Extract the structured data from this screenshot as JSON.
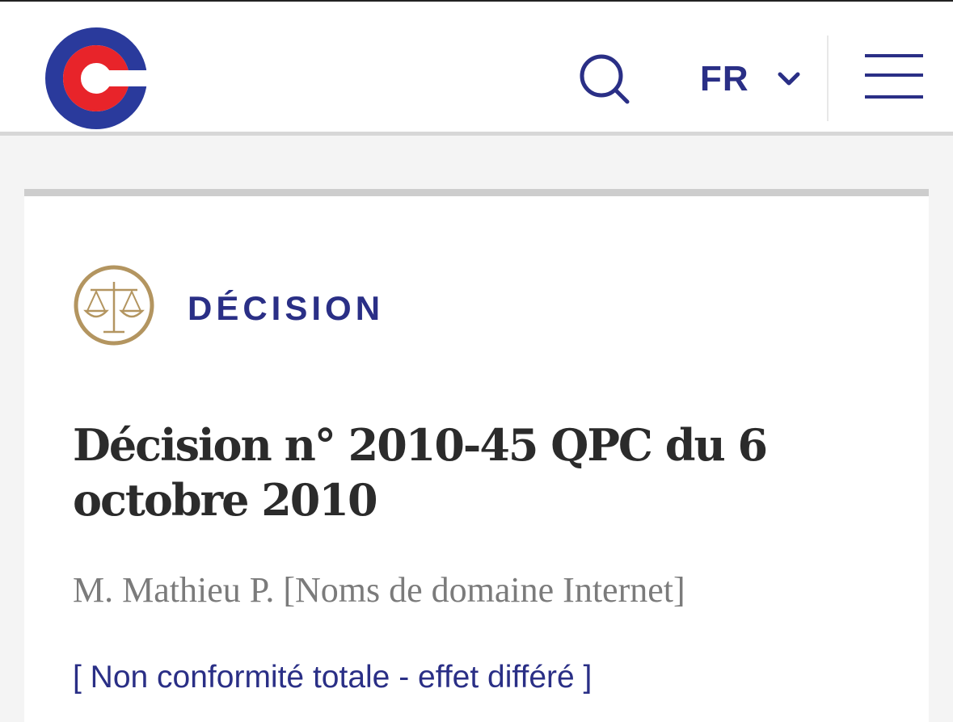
{
  "header": {
    "language": "FR"
  },
  "brand": {
    "blue": "#2a3a9c",
    "red": "#e8242a",
    "gold": "#b39560",
    "navy": "#2a2f86"
  },
  "icons": {
    "logo": "conseil-constitutionnel-logo",
    "search": "search-icon",
    "language_toggle": "chevron-down-icon",
    "menu": "hamburger-menu-icon",
    "category": "scales-of-justice-icon"
  },
  "decision": {
    "category": "DÉCISION",
    "title": "Décision n° 2010-45 QPC du 6 octobre 2010",
    "subtitle": "M. Mathieu P. [Noms de domaine Internet]",
    "status": "[ Non conformité totale - effet différé ]"
  }
}
